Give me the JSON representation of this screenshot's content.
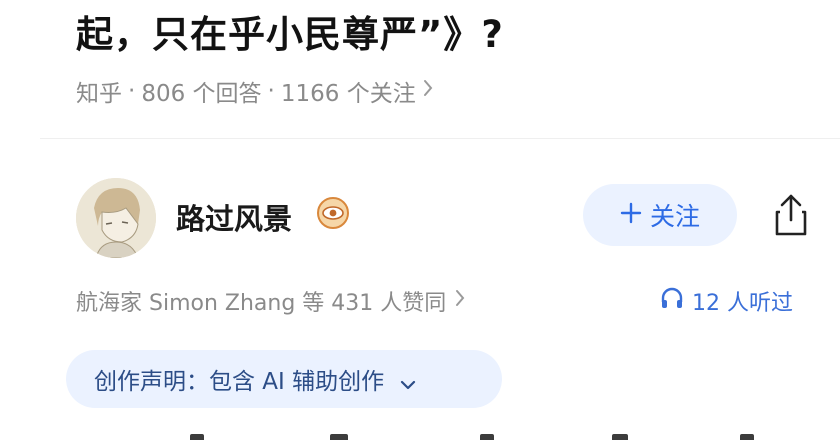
{
  "question": {
    "title_fragment": "起，只在乎小民尊严”》?",
    "meta": {
      "source": "知乎",
      "answers": "806 个回答",
      "followers": "1166 个关注",
      "separator": "·"
    }
  },
  "answer": {
    "author": {
      "name": "路过风景",
      "badge_icon": "eye-badge-icon"
    },
    "follow_label": "关注",
    "endorsement": "航海家 Simon Zhang 等 431 人赞同",
    "listened": "12 人听过",
    "declaration": "创作声明：包含 AI 辅助创作"
  },
  "colors": {
    "accent": "#2d6be5",
    "pill_bg": "#ebf2ff",
    "meta_text": "#8a8a8a"
  }
}
